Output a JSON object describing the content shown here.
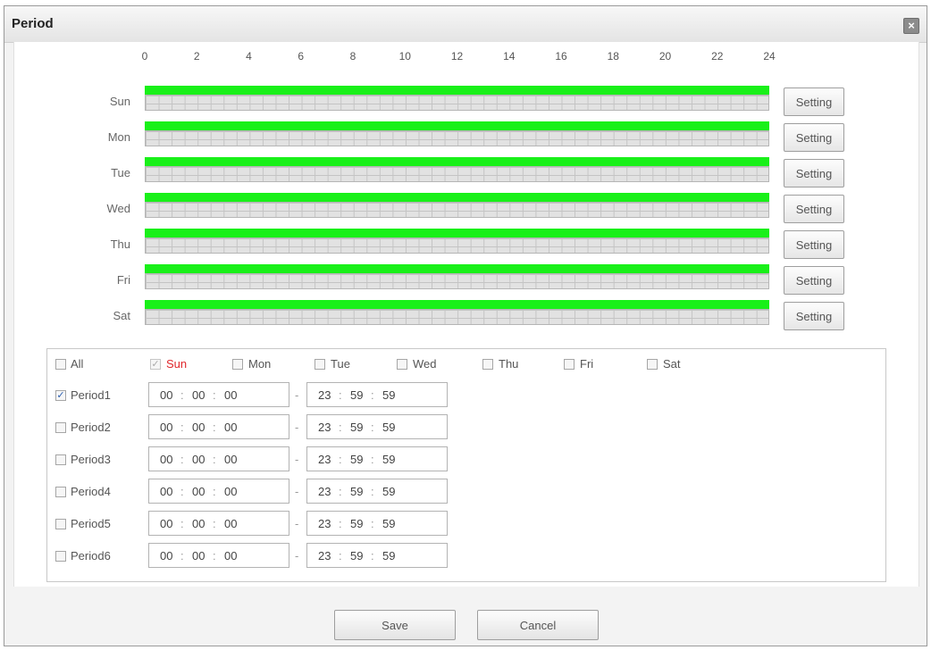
{
  "dialog": {
    "title": "Period"
  },
  "schedule": {
    "hour_ticks": [
      "0",
      "2",
      "4",
      "6",
      "8",
      "10",
      "12",
      "14",
      "16",
      "18",
      "20",
      "22",
      "24"
    ],
    "days": [
      {
        "label": "Sun",
        "active_start": 0,
        "active_end": 24
      },
      {
        "label": "Mon",
        "active_start": 0,
        "active_end": 24
      },
      {
        "label": "Tue",
        "active_start": 0,
        "active_end": 24
      },
      {
        "label": "Wed",
        "active_start": 0,
        "active_end": 24
      },
      {
        "label": "Thu",
        "active_start": 0,
        "active_end": 24
      },
      {
        "label": "Fri",
        "active_start": 0,
        "active_end": 24
      },
      {
        "label": "Sat",
        "active_start": 0,
        "active_end": 24
      }
    ],
    "setting_label": "Setting",
    "active_color": "#19f019"
  },
  "day_select": {
    "all": {
      "label": "All",
      "checked": false
    },
    "days": [
      {
        "label": "Sun",
        "checked": true,
        "disabled": true,
        "highlight": true
      },
      {
        "label": "Mon",
        "checked": false
      },
      {
        "label": "Tue",
        "checked": false
      },
      {
        "label": "Wed",
        "checked": false
      },
      {
        "label": "Thu",
        "checked": false
      },
      {
        "label": "Fri",
        "checked": false
      },
      {
        "label": "Sat",
        "checked": false
      }
    ]
  },
  "periods": [
    {
      "label": "Period1",
      "checked": true,
      "start": [
        "00",
        "00",
        "00"
      ],
      "end": [
        "23",
        "59",
        "59"
      ]
    },
    {
      "label": "Period2",
      "checked": false,
      "start": [
        "00",
        "00",
        "00"
      ],
      "end": [
        "23",
        "59",
        "59"
      ]
    },
    {
      "label": "Period3",
      "checked": false,
      "start": [
        "00",
        "00",
        "00"
      ],
      "end": [
        "23",
        "59",
        "59"
      ]
    },
    {
      "label": "Period4",
      "checked": false,
      "start": [
        "00",
        "00",
        "00"
      ],
      "end": [
        "23",
        "59",
        "59"
      ]
    },
    {
      "label": "Period5",
      "checked": false,
      "start": [
        "00",
        "00",
        "00"
      ],
      "end": [
        "23",
        "59",
        "59"
      ]
    },
    {
      "label": "Period6",
      "checked": false,
      "start": [
        "00",
        "00",
        "00"
      ],
      "end": [
        "23",
        "59",
        "59"
      ]
    }
  ],
  "time_separator": ":",
  "range_separator": "-",
  "footer": {
    "save_label": "Save",
    "cancel_label": "Cancel"
  }
}
